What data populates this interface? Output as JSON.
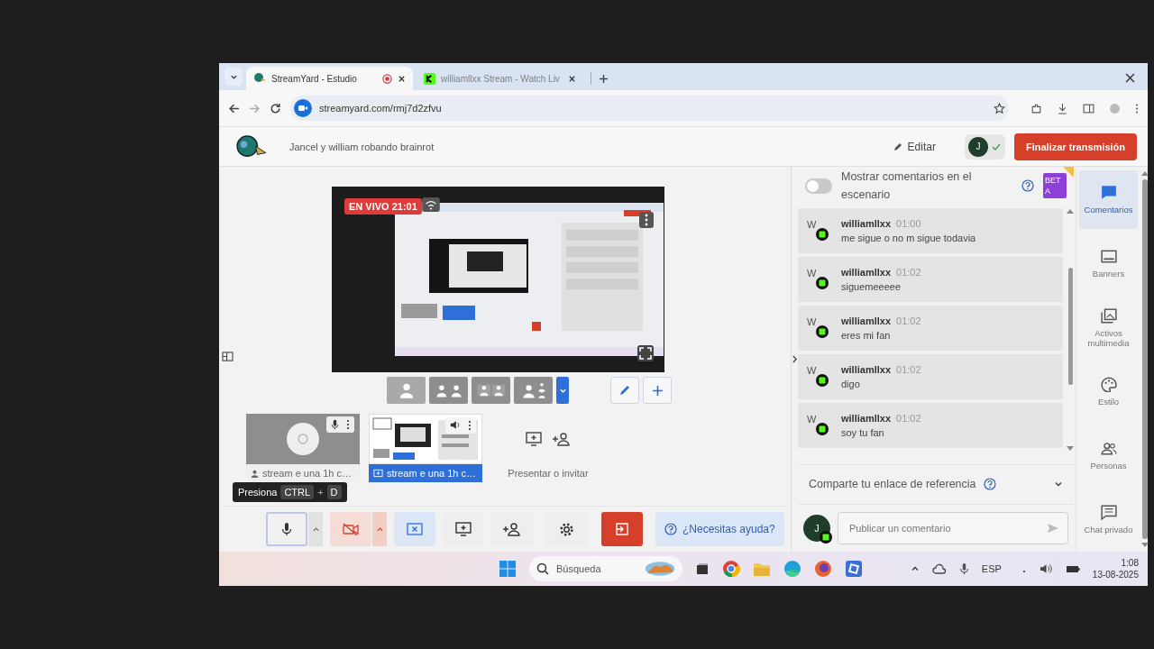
{
  "browser": {
    "tabs": [
      {
        "title": "StreamYard - Estudio",
        "selected": true,
        "recording": true
      },
      {
        "title": "williamllxx Stream - Watch Liv",
        "selected": false,
        "recording": false
      }
    ],
    "url": "streamyard.com/rmj7d2zfvu"
  },
  "header": {
    "title": "Jancel y william robando brainrot",
    "edit_label": "Editar",
    "host_initial": "J",
    "end_button": "Finalizar transmisión"
  },
  "stage": {
    "live_badge": "EN VIVO 21:01",
    "sources": [
      {
        "kind": "camera",
        "label": "stream e una 1h c…",
        "selected": false
      },
      {
        "kind": "screen",
        "label": "stream e una 1h c…",
        "selected": true
      },
      {
        "kind": "add",
        "label": "Presentar o invitar",
        "selected": false
      }
    ],
    "tooltip": {
      "text": "Presiona",
      "keys": [
        "CTRL",
        "D"
      ],
      "separator": "+"
    },
    "controls": {
      "mic_focused": true,
      "camera_off": true,
      "help": "¿Necesitas ayuda?"
    }
  },
  "comments": {
    "show_on_stage": {
      "label": "Mostrar comentarios en el escenario",
      "on": false
    },
    "badge": "BETA",
    "items": [
      {
        "initial": "W",
        "author": "williamllxx",
        "time": "01:00",
        "text": "me sigue o no m sigue todavia"
      },
      {
        "initial": "W",
        "author": "williamllxx",
        "time": "01:02",
        "text": "siguemeeeee"
      },
      {
        "initial": "W",
        "author": "williamllxx",
        "time": "01:02",
        "text": "eres mi fan"
      },
      {
        "initial": "W",
        "author": "williamllxx",
        "time": "01:02",
        "text": "digo"
      },
      {
        "initial": "W",
        "author": "williamllxx",
        "time": "01:02",
        "text": "soy tu fan"
      }
    ],
    "referral": "Comparte tu enlace de referencia",
    "composer": {
      "initial": "J",
      "placeholder": "Publicar un comentario"
    }
  },
  "nav": {
    "items": [
      {
        "kind": "comments",
        "label": "Comentarios",
        "selected": true
      },
      {
        "kind": "banners",
        "label": "Banners",
        "selected": false
      },
      {
        "kind": "media",
        "label": "Activos multimedia",
        "selected": false
      },
      {
        "kind": "style",
        "label": "Estilo",
        "selected": false
      },
      {
        "kind": "people",
        "label": "Personas",
        "selected": false
      },
      {
        "kind": "chat",
        "label": "Chat privado",
        "selected": false
      }
    ]
  },
  "taskbar": {
    "search": "Búsqueda",
    "language": "ESP",
    "time": "1:08",
    "date": "13-08-2025"
  }
}
